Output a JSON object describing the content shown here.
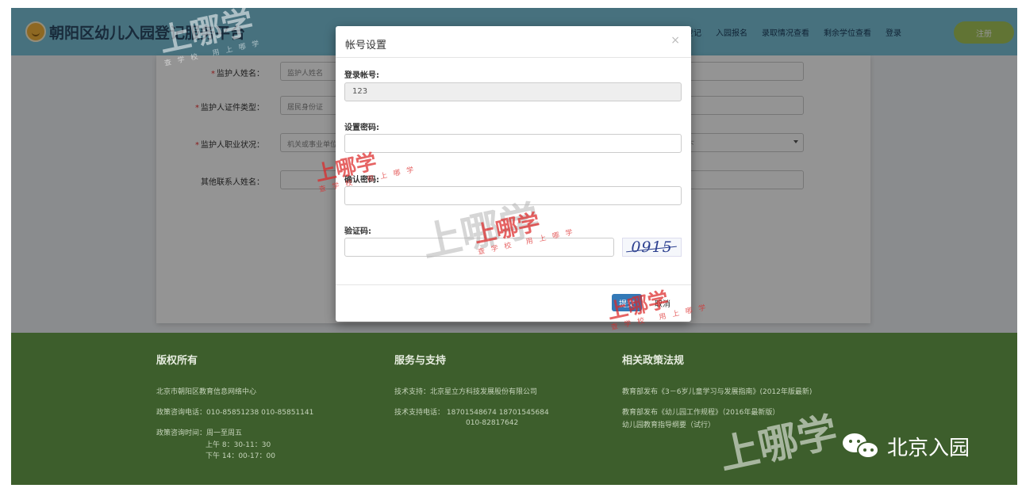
{
  "header": {
    "site_title": "朝阳区幼儿入园登记服务平台",
    "nav": [
      "登记",
      "入园报名",
      "录取情况查看",
      "剩余学位查看",
      "登录"
    ],
    "register_label": "注册"
  },
  "form": {
    "rows": [
      {
        "label": "监护人姓名：",
        "required": true,
        "value": "监护人姓名",
        "right_value": ""
      },
      {
        "label": "监护人证件类型：",
        "required": true,
        "value": "居民身份证",
        "right_value": ""
      },
      {
        "label": "监护人职业状况：",
        "required": true,
        "value": "机关或事业单位",
        "right_value": "下"
      },
      {
        "label": "其他联系人姓名：",
        "required": false,
        "value": "",
        "right_value": ""
      }
    ]
  },
  "modal": {
    "title": "帐号设置",
    "close": "×",
    "account_label": "登录帐号:",
    "account_value": "123",
    "password_label": "设置密码:",
    "confirm_label": "确认密码:",
    "captcha_label": "验证码:",
    "captcha_text": "0915",
    "submit_label": "提交",
    "cancel_label": "取消"
  },
  "footer": {
    "columns": [
      {
        "heading": "版权所有",
        "lines": [
          "北京市朝阳区教育信息网络中心",
          "政策咨询电话：010-85851238  010-85851141",
          "政策咨询时间：周一至周五"
        ],
        "sub": [
          "上午 8：30-11：30",
          "下午 14：00-17：00"
        ]
      },
      {
        "heading": "服务与支持",
        "lines": [
          "技术支持：北京星立方科技发展股份有限公司",
          "技术支持电话： 18701548674  18701545684"
        ],
        "sub": [
          "010-82817642"
        ]
      },
      {
        "heading": "相关政策法规",
        "lines": [
          "教育部发布《3－6岁儿童学习与发展指南》(2012年版最新)",
          "教育部发布《幼儿园工作规程》（2016年最新版）",
          "幼儿园教育指导纲要（试行）"
        ],
        "sub": []
      }
    ]
  },
  "wechat": {
    "icon": "wechat-icon",
    "label": "北京入园"
  },
  "watermark": {
    "main": "上哪学",
    "sub": "查学校 用上哪学"
  }
}
